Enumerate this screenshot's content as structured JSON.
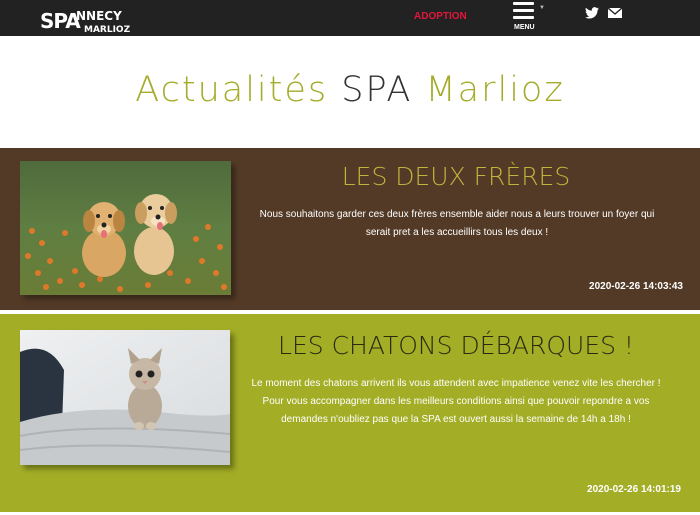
{
  "header": {
    "logo": {
      "brand": "SPA",
      "city": "NNECY",
      "site": "MARLIOZ"
    },
    "adoption_label": "ADOPTION",
    "menu_label": "MENU",
    "social": [
      "twitter-icon",
      "mail-icon"
    ]
  },
  "page": {
    "title_part1": "Actualités ",
    "title_part2": "SPA",
    "title_part3": " Marlioz"
  },
  "articles": [
    {
      "title": "LES DEUX FRÈRES",
      "excerpt": "Nous souhaitons garder ces deux frères ensemble aider nous a leurs trouver un foyer qui serait pret a les accueillirs tous les deux !",
      "date": "2020-02-26 14:03:43",
      "image": "puppies-photo"
    },
    {
      "title": "LES CHATONS DÉBARQUES !",
      "excerpt": "Le moment des chatons arrivent ils vous attendent avec impatience venez vite les chercher ! Pour vous accompagner dans les meilleurs conditions ainsi que pouvoir repondre a vos demandes n'oubliez pas que la SPA est ouvert aussi la semaine de 14h a 18h !",
      "date": "2020-02-26 14:01:19",
      "image": "kitten-photo"
    }
  ],
  "colors": {
    "topbar": "#222222",
    "accent": "#a4ac2a",
    "adoption": "#e2173c",
    "article1_bg": "#533a26",
    "article2_bg": "#a3ad26"
  }
}
